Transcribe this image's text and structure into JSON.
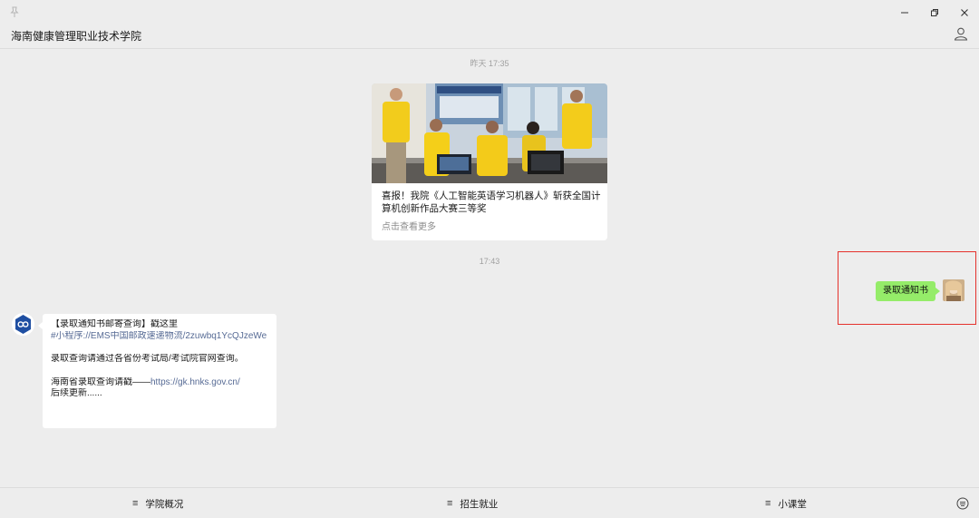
{
  "window": {
    "pin_icon": "pin-icon",
    "minimize_icon": "minimize-icon",
    "restore_icon": "restore-icon",
    "close_icon": "close-icon"
  },
  "header": {
    "title": "海南健康管理职业技术学院",
    "profile_icon": "person-icon"
  },
  "messages": {
    "time1": "昨天 17:35",
    "article": {
      "title": "喜报！我院《人工智能英语学习机器人》斩获全国计算机创新作品大赛三等奖",
      "more": "点击查看更多"
    },
    "time2": "17:43",
    "sent": {
      "text": "录取通知书"
    },
    "received": {
      "line1": "【录取通知书邮寄查询】戳这里",
      "link1": "#小程序://EMS中国邮政速递物流/2zuwbq1YcQJzeWe",
      "line2": "录取查询请通过各省份考试局/考试院官网查询。",
      "line3_prefix": "海南省录取查询请戳——",
      "link2": "https://gk.hnks.gov.cn/",
      "line4": "后续更新......"
    }
  },
  "menu": {
    "items": [
      {
        "label": "学院概况"
      },
      {
        "label": "招生就业"
      },
      {
        "label": "小课堂"
      }
    ],
    "menu_glyph": "≡",
    "keyboard_icon": "keyboard-icon"
  },
  "colors": {
    "sent_bubble": "#95ec69",
    "highlight_border": "#e5322d",
    "link": "#576b95"
  }
}
